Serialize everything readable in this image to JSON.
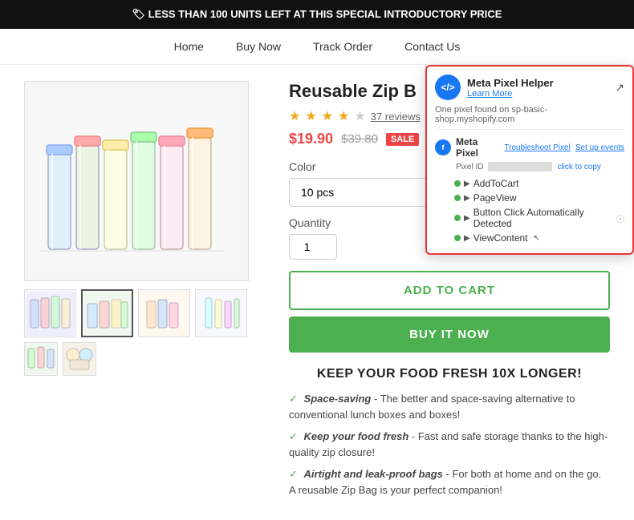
{
  "topBanner": {
    "text": "🏷 LESS THAN 100 UNITS LEFT AT THIS SPECIAL INTRODUCTORY PRICE"
  },
  "nav": {
    "links": [
      "Home",
      "Buy Now",
      "Track Order",
      "Contact Us"
    ]
  },
  "product": {
    "title": "Reusable Zip B",
    "titleFull": "Reusable Zip Bag",
    "stars": 4,
    "reviewCount": "37 reviews",
    "priceSale": "$19.90",
    "priceOriginal": "$39.80",
    "saleBadge": "SALE",
    "colorLabel": "Color",
    "colorOption": "10 pcs",
    "quantityLabel": "Quantity",
    "quantityValue": "1",
    "addToCartLabel": "ADD TO CART",
    "buyNowLabel": "BUY IT NOW"
  },
  "description": {
    "heading": "KEEP YOUR FOOD FRESH 10X LONGER!",
    "items": [
      {
        "bold": "Space-saving",
        "text": " - The better and space-saving alternative to conventional lunch boxes and boxes!"
      },
      {
        "bold": "Keep your food fresh",
        "text": " - Fast and safe storage thanks to the high-quality zip closure!"
      },
      {
        "bold": "Airtight and leak-proof bags",
        "text": " - For both at home and on the go. A reusable Zip Bag is your perfect companion!"
      }
    ]
  },
  "pixelHelper": {
    "title": "Meta Pixel Helper",
    "learnMore": "Learn More",
    "domain": "One pixel found on sp-basic-shop.myshopify.com",
    "pixelName": "Meta Pixel",
    "pixelIdLabel": "Pixel ID",
    "copyLabel": "click to copy",
    "troubleshootLink": "Troubleshoot Pixel",
    "setupLink": "Set up events",
    "events": [
      {
        "label": "AddToCart",
        "hasArrow": true
      },
      {
        "label": "PageView",
        "hasArrow": true
      },
      {
        "label": "Button Click Automatically Detected",
        "hasArrow": true,
        "hasInfo": true
      },
      {
        "label": "ViewContent",
        "hasArrow": true,
        "hasCursor": true
      }
    ]
  },
  "colors": {
    "green": "#4caf50",
    "sale": "#e44444",
    "blue": "#1877f2",
    "popupBorder": "#dd3333"
  }
}
